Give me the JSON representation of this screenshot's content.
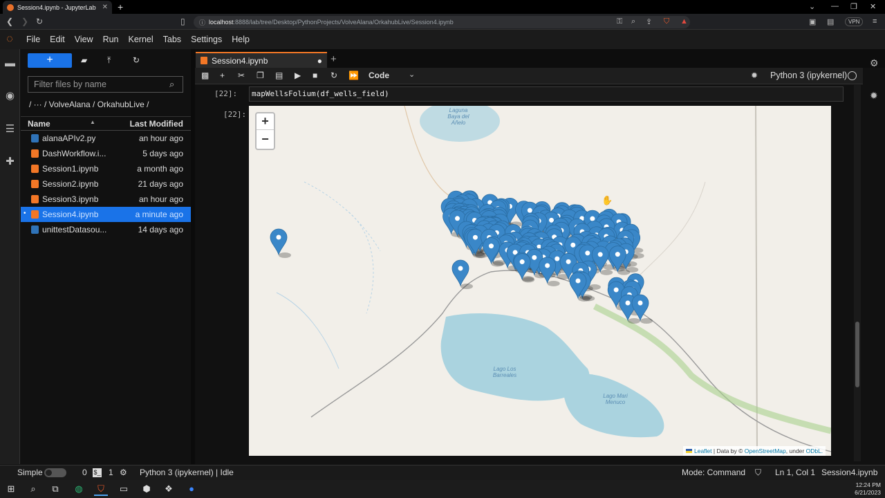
{
  "browser": {
    "tab_title": "Session4.ipynb - JupyterLab",
    "url_host": "localhost",
    "url_rest": ":8888/lab/tree/Desktop/PythonProjects/VolveAlana/OrkahubLive/Session4.ipynb",
    "vpn_label": "VPN"
  },
  "menu": [
    "File",
    "Edit",
    "View",
    "Run",
    "Kernel",
    "Tabs",
    "Settings",
    "Help"
  ],
  "filebrowser": {
    "filter_placeholder": "Filter files by name",
    "breadcrumb": "/   ···  / VolveAlana / OrkahubLive /",
    "col_name": "Name",
    "col_modified": "Last Modified",
    "files": [
      {
        "name": "alanaAPIv2.py",
        "modified": "an hour ago",
        "type": "py",
        "selected": false
      },
      {
        "name": "DashWorkflow.i...",
        "modified": "5 days ago",
        "type": "ipynb",
        "selected": false
      },
      {
        "name": "Session1.ipynb",
        "modified": "a month ago",
        "type": "ipynb",
        "selected": false
      },
      {
        "name": "Session2.ipynb",
        "modified": "21 days ago",
        "type": "ipynb",
        "selected": false
      },
      {
        "name": "Session3.ipynb",
        "modified": "an hour ago",
        "type": "ipynb",
        "selected": false
      },
      {
        "name": "Session4.ipynb",
        "modified": "a minute ago",
        "type": "ipynb",
        "selected": true
      },
      {
        "name": "unittestDatasou...",
        "modified": "14 days ago",
        "type": "py",
        "selected": false
      }
    ]
  },
  "notebook": {
    "tab_label": "Session4.ipynb",
    "cell_type": "Code",
    "kernel": "Python 3 (ipykernel)",
    "in_prompt": "[22]:",
    "out_prompt": "[22]:",
    "code": "mapWellsFolium(df_wells_field)"
  },
  "map": {
    "zoom_in": "+",
    "zoom_out": "−",
    "lake1": "Laguna\nBaya del\nAñelo",
    "lake2": "Lago Los\nBarreales",
    "lake3": "Lago Mari\nMenuco",
    "attrib_leaflet": "Leaflet",
    "attrib_mid": " | Data by © ",
    "attrib_osm": "OpenStreetMap",
    "attrib_under": ", under ",
    "attrib_odbl": "ODbL.",
    "marker_color": "#3a87c8",
    "water_color": "#aad3df"
  },
  "statusbar": {
    "mode_simple": "Simple",
    "count0": "0",
    "count1": "1",
    "kernel_status": "Python 3 (ipykernel) | Idle",
    "mode": "Mode: Command",
    "position": "Ln 1, Col 1",
    "filename": "Session4.ipynb"
  },
  "taskbar": {
    "time": "12:24 PM",
    "date": "6/21/2023"
  }
}
